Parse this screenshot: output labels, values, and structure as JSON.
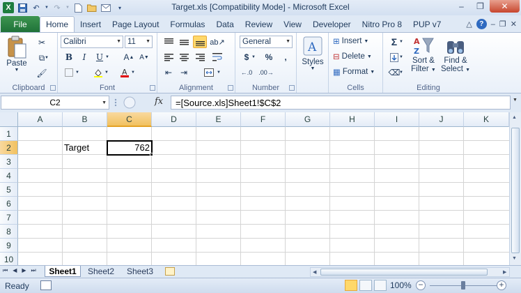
{
  "window": {
    "title": "Target.xls  [Compatibility Mode]  -  Microsoft Excel"
  },
  "tabs": [
    {
      "label": "File"
    },
    {
      "label": "Home"
    },
    {
      "label": "Insert"
    },
    {
      "label": "Page Layout"
    },
    {
      "label": "Formulas"
    },
    {
      "label": "Data"
    },
    {
      "label": "Review"
    },
    {
      "label": "View"
    },
    {
      "label": "Developer"
    },
    {
      "label": "Nitro Pro 8"
    },
    {
      "label": "PUP v7"
    }
  ],
  "ribbon": {
    "clipboard": {
      "label": "Clipboard",
      "paste": "Paste"
    },
    "font": {
      "label": "Font",
      "name": "Calibri",
      "size": "11"
    },
    "alignment": {
      "label": "Alignment"
    },
    "number": {
      "label": "Number",
      "format": "General",
      "currency": "$",
      "percent": "%",
      "comma": ","
    },
    "styles": {
      "label": "Styles"
    },
    "cells": {
      "label": "Cells",
      "insert": "Insert",
      "delete": "Delete",
      "format": "Format"
    },
    "editing": {
      "label": "Editing",
      "sort": "Sort &",
      "sort2": "Filter",
      "find": "Find &",
      "find2": "Select"
    }
  },
  "formula_bar": {
    "name_box": "C2",
    "fx": "fx",
    "formula": "=[Source.xls]Sheet1!$C$2"
  },
  "grid": {
    "columns": [
      "A",
      "B",
      "C",
      "D",
      "E",
      "F",
      "G",
      "H",
      "I",
      "J",
      "K"
    ],
    "rows": [
      "1",
      "2",
      "3",
      "4",
      "5",
      "6",
      "7",
      "8",
      "9",
      "10"
    ],
    "selected_column": "C",
    "selected_row": "2",
    "cells": {
      "B2": "Target",
      "C2": "762"
    }
  },
  "sheets": [
    {
      "name": "Sheet1",
      "active": true
    },
    {
      "name": "Sheet2",
      "active": false
    },
    {
      "name": "Sheet3",
      "active": false
    }
  ],
  "status": {
    "mode": "Ready",
    "zoom": "100%",
    "zoom_fraction": 0.5
  }
}
